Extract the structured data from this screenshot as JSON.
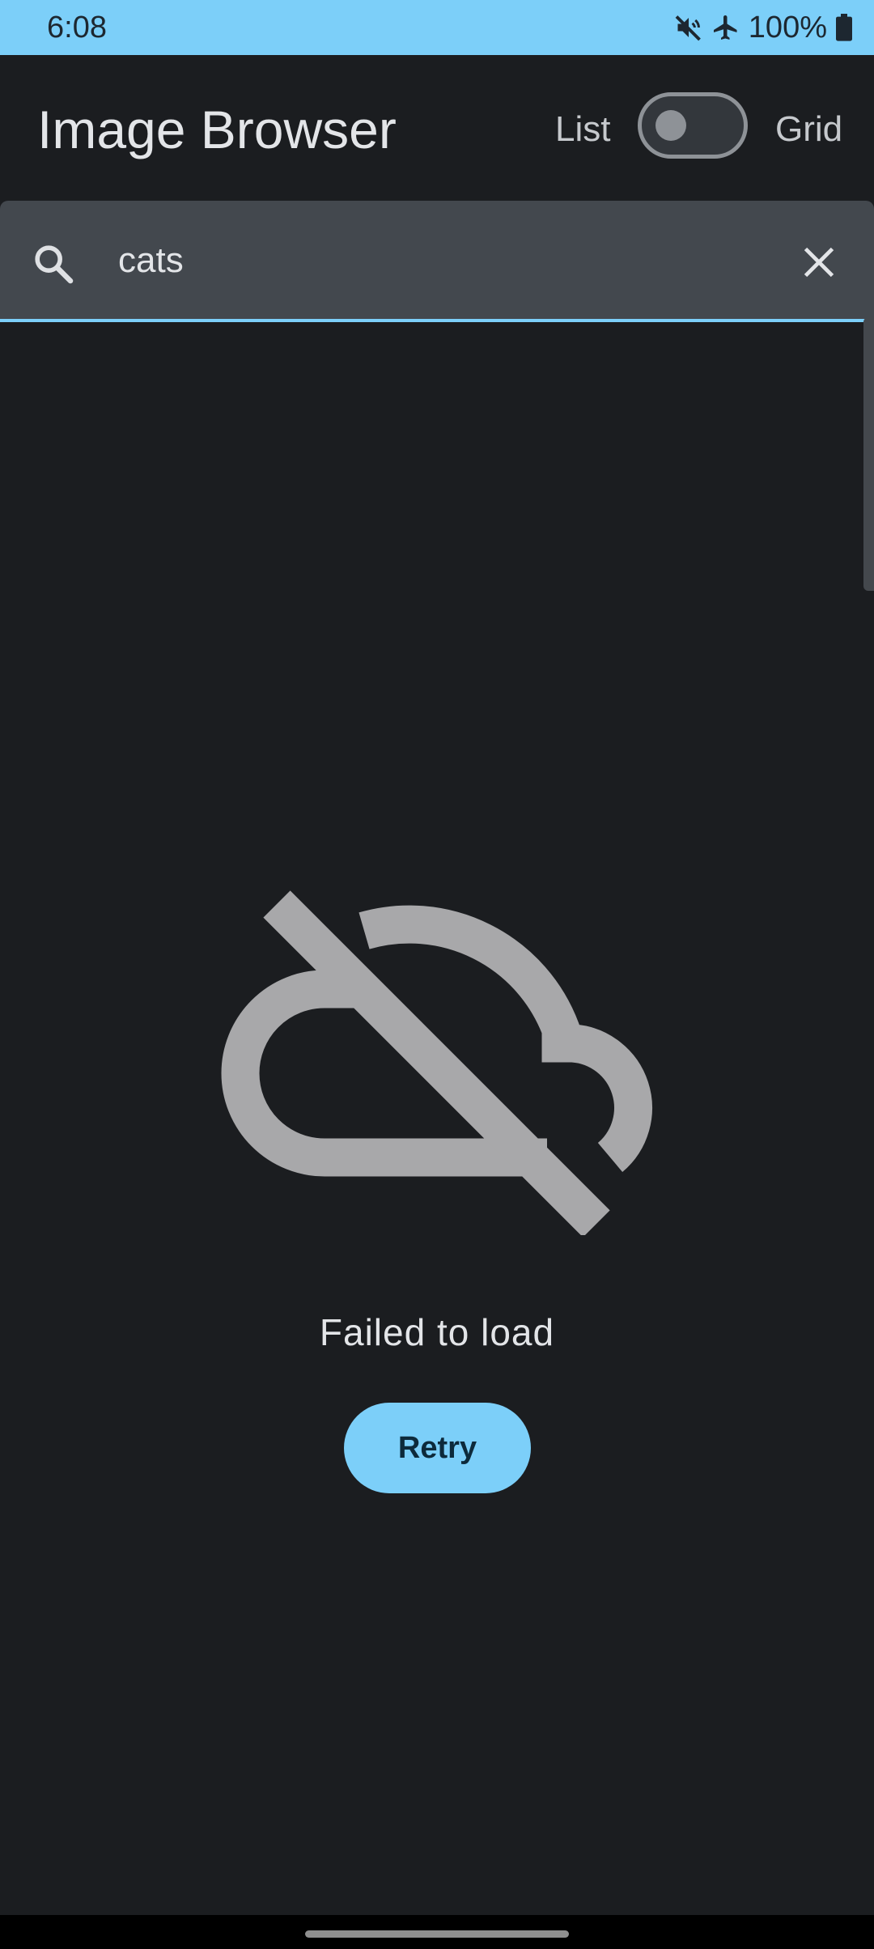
{
  "status_bar": {
    "time": "6:08",
    "battery": "100%",
    "icons": [
      "mute-icon",
      "airplane-mode-icon",
      "battery-icon"
    ]
  },
  "app_bar": {
    "title": "Image Browser",
    "toggle": {
      "left_label": "List",
      "right_label": "Grid",
      "state": "List"
    }
  },
  "search": {
    "value": "cats",
    "icon": "search-icon",
    "clear_icon": "close-icon"
  },
  "error_state": {
    "icon": "cloud-off-icon",
    "message": "Failed to load",
    "retry_label": "Retry"
  },
  "colors": {
    "accent": "#7ccff9",
    "background": "#1b1d20",
    "search_field": "#43484e",
    "icon_gray": "#a8a8aa"
  }
}
